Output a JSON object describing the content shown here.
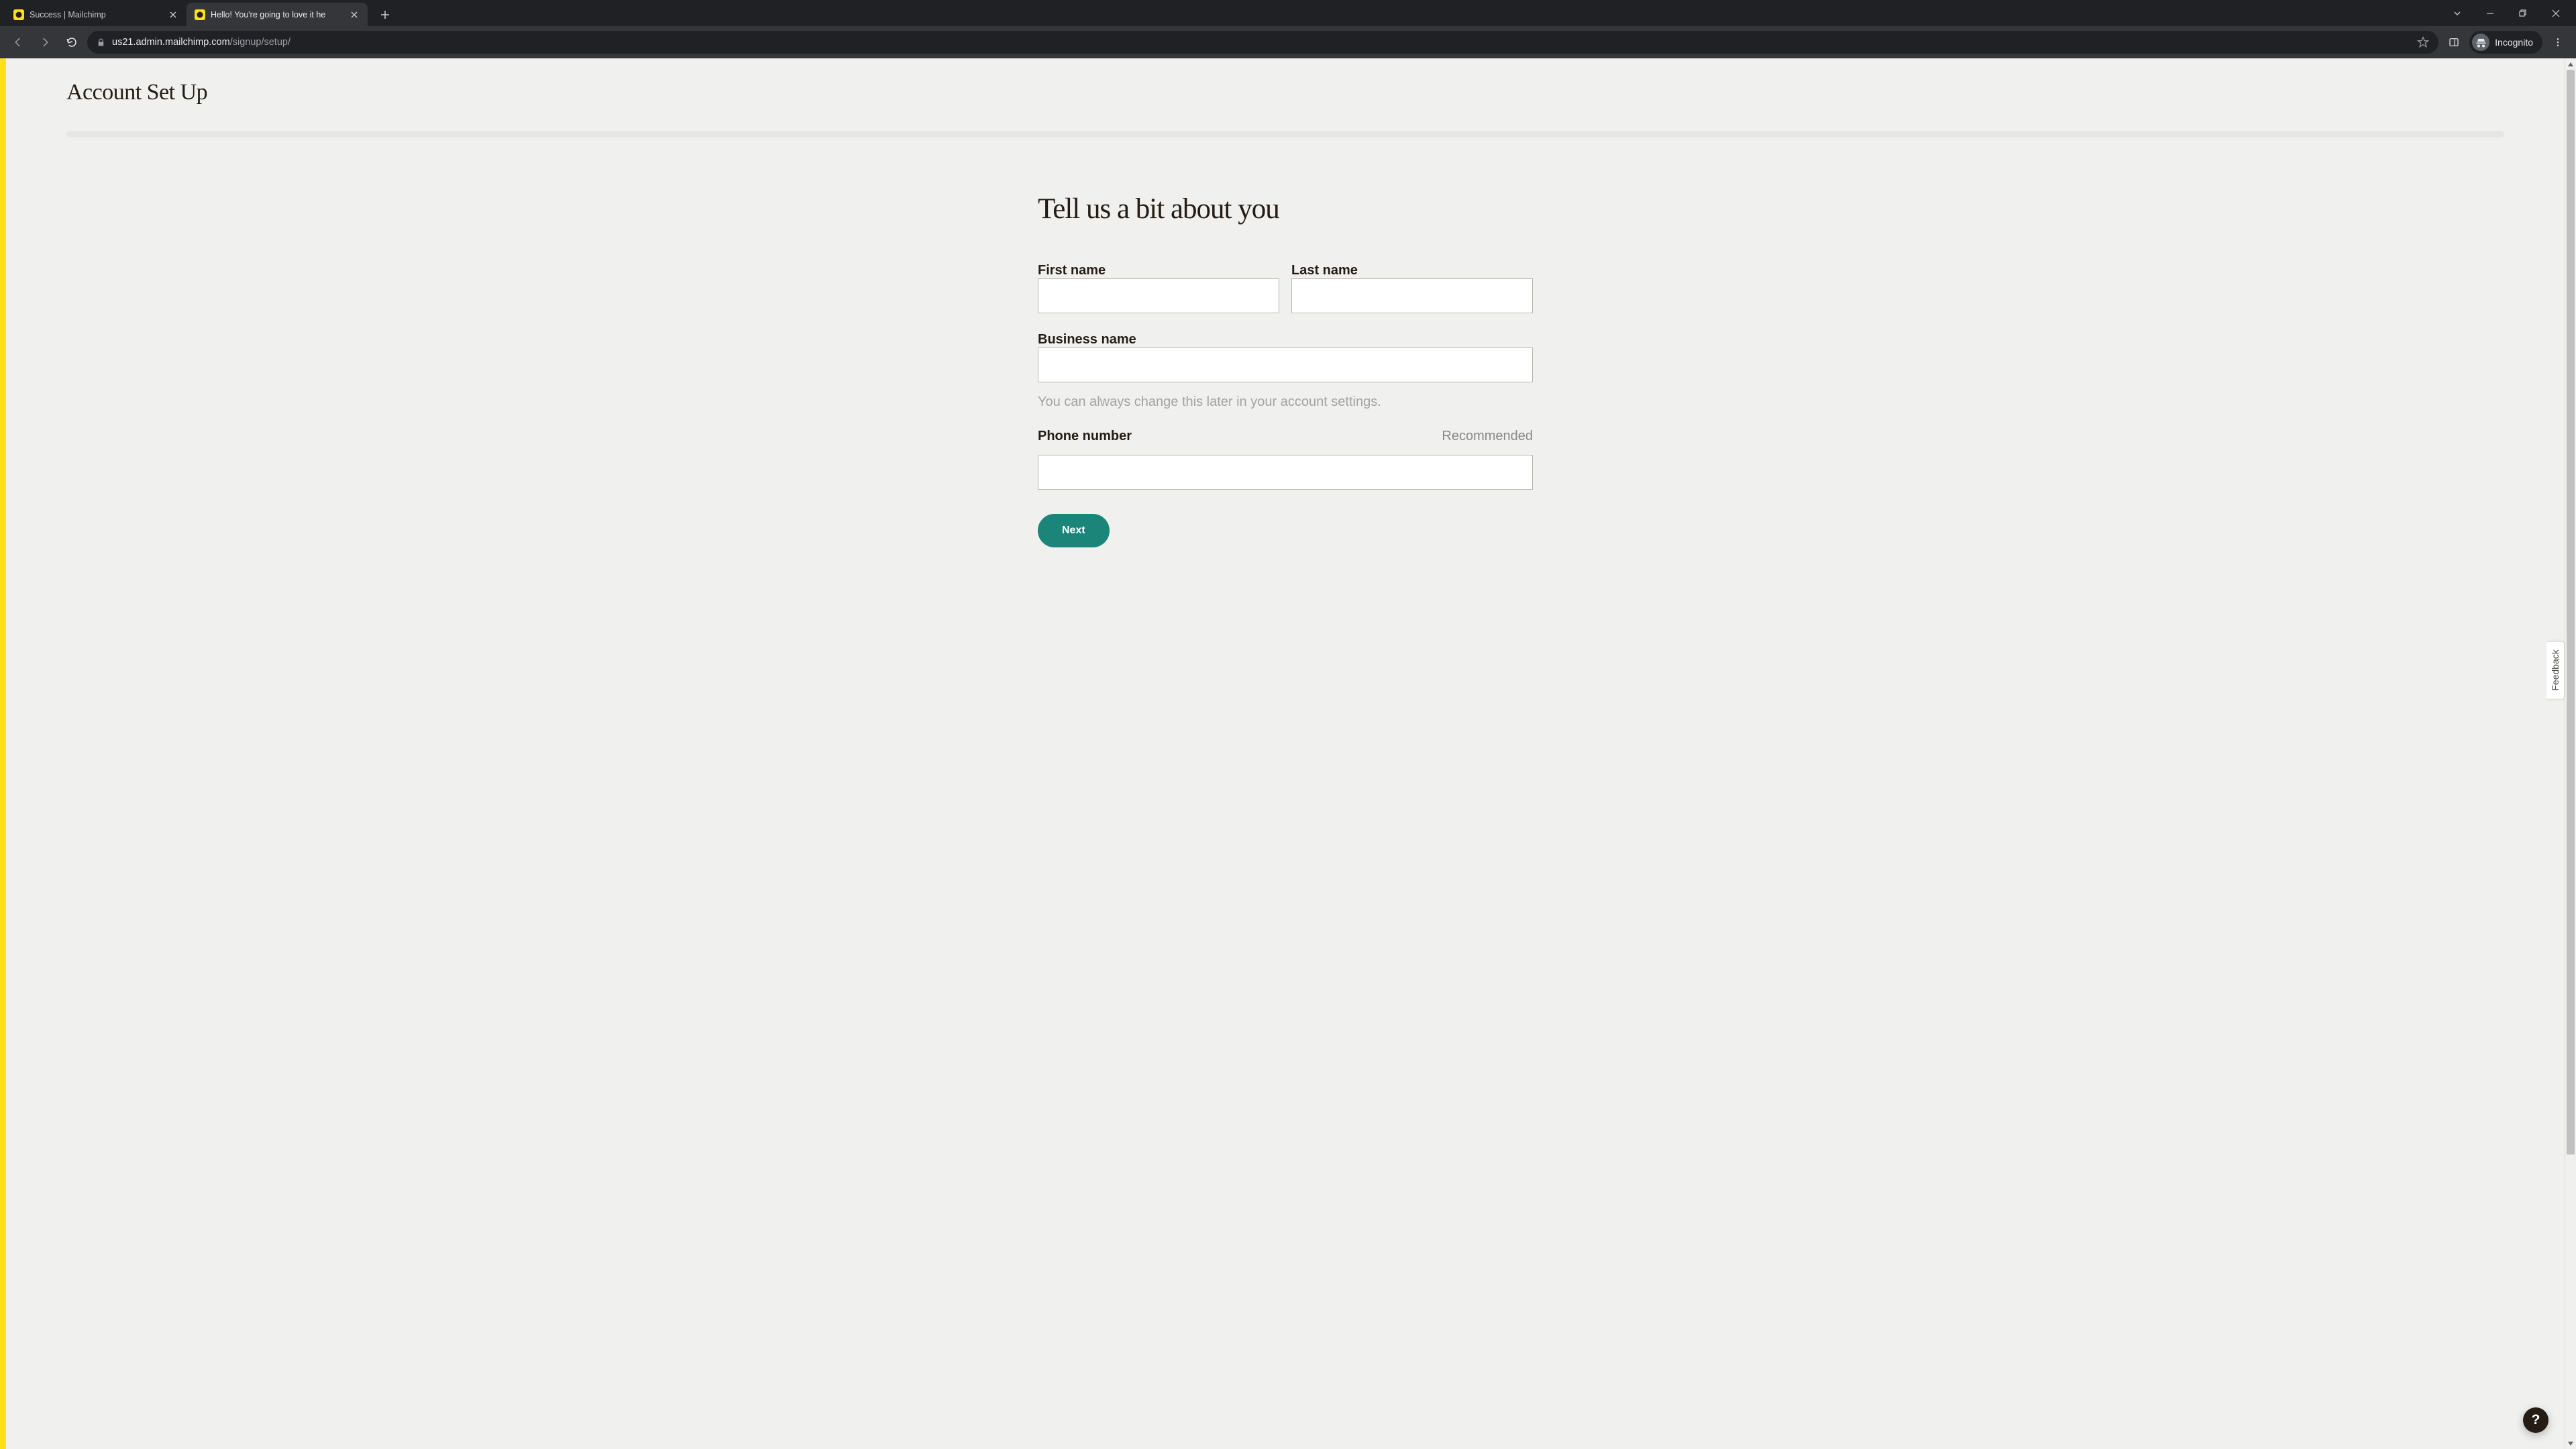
{
  "browser": {
    "tabs": [
      {
        "title": "Success | Mailchimp",
        "active": false
      },
      {
        "title": "Hello! You're going to love it he",
        "active": true
      }
    ],
    "url_host": "us21.admin.mailchimp.com",
    "url_path": "/signup/setup/",
    "incognito_label": "Incognito"
  },
  "page": {
    "header_title": "Account Set Up",
    "form_heading": "Tell us a bit about you",
    "fields": {
      "first_name": {
        "label": "First name",
        "value": ""
      },
      "last_name": {
        "label": "Last name",
        "value": ""
      },
      "business_name": {
        "label": "Business name",
        "value": "",
        "helper": "You can always change this later in your account settings."
      },
      "phone": {
        "label": "Phone number",
        "aside": "Recommended",
        "value": ""
      }
    },
    "next_button": "Next",
    "feedback_label": "Feedback",
    "help_label": "?"
  }
}
